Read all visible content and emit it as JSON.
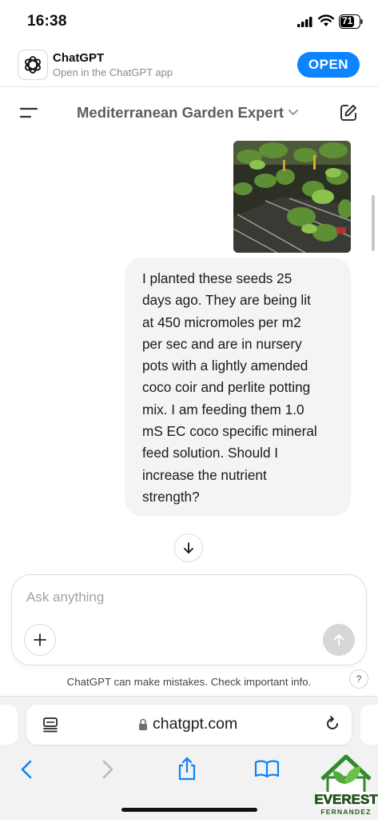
{
  "status_bar": {
    "time": "16:38",
    "battery": "71"
  },
  "app_banner": {
    "name": "ChatGPT",
    "subtitle": "Open in the ChatGPT app",
    "open_label": "OPEN"
  },
  "chat_header": {
    "title": "Mediterranean Garden Expert"
  },
  "message": {
    "text": "I planted these seeds 25\ndays ago. They are being lit\nat 450 micromoles per m2\nper sec and are in nursery\npots with a lightly amended\ncoco coir and perlite potting\nmix. I am feeding them 1.0\nmS EC coco specific mineral\nfeed solution. Should I\nincrease the nutrient\nstrength?"
  },
  "composer": {
    "placeholder": "Ask anything"
  },
  "disclaimer": "ChatGPT can make mistakes. Check important info.",
  "help_label": "?",
  "safari": {
    "url": "chatgpt.com"
  },
  "watermark": {
    "line1": "EVEREST",
    "line2": "FERNANDEZ"
  },
  "colors": {
    "accent": "#0a84ff",
    "bubble": "#f4f4f4",
    "watermark_green": "#3a9a2e"
  }
}
